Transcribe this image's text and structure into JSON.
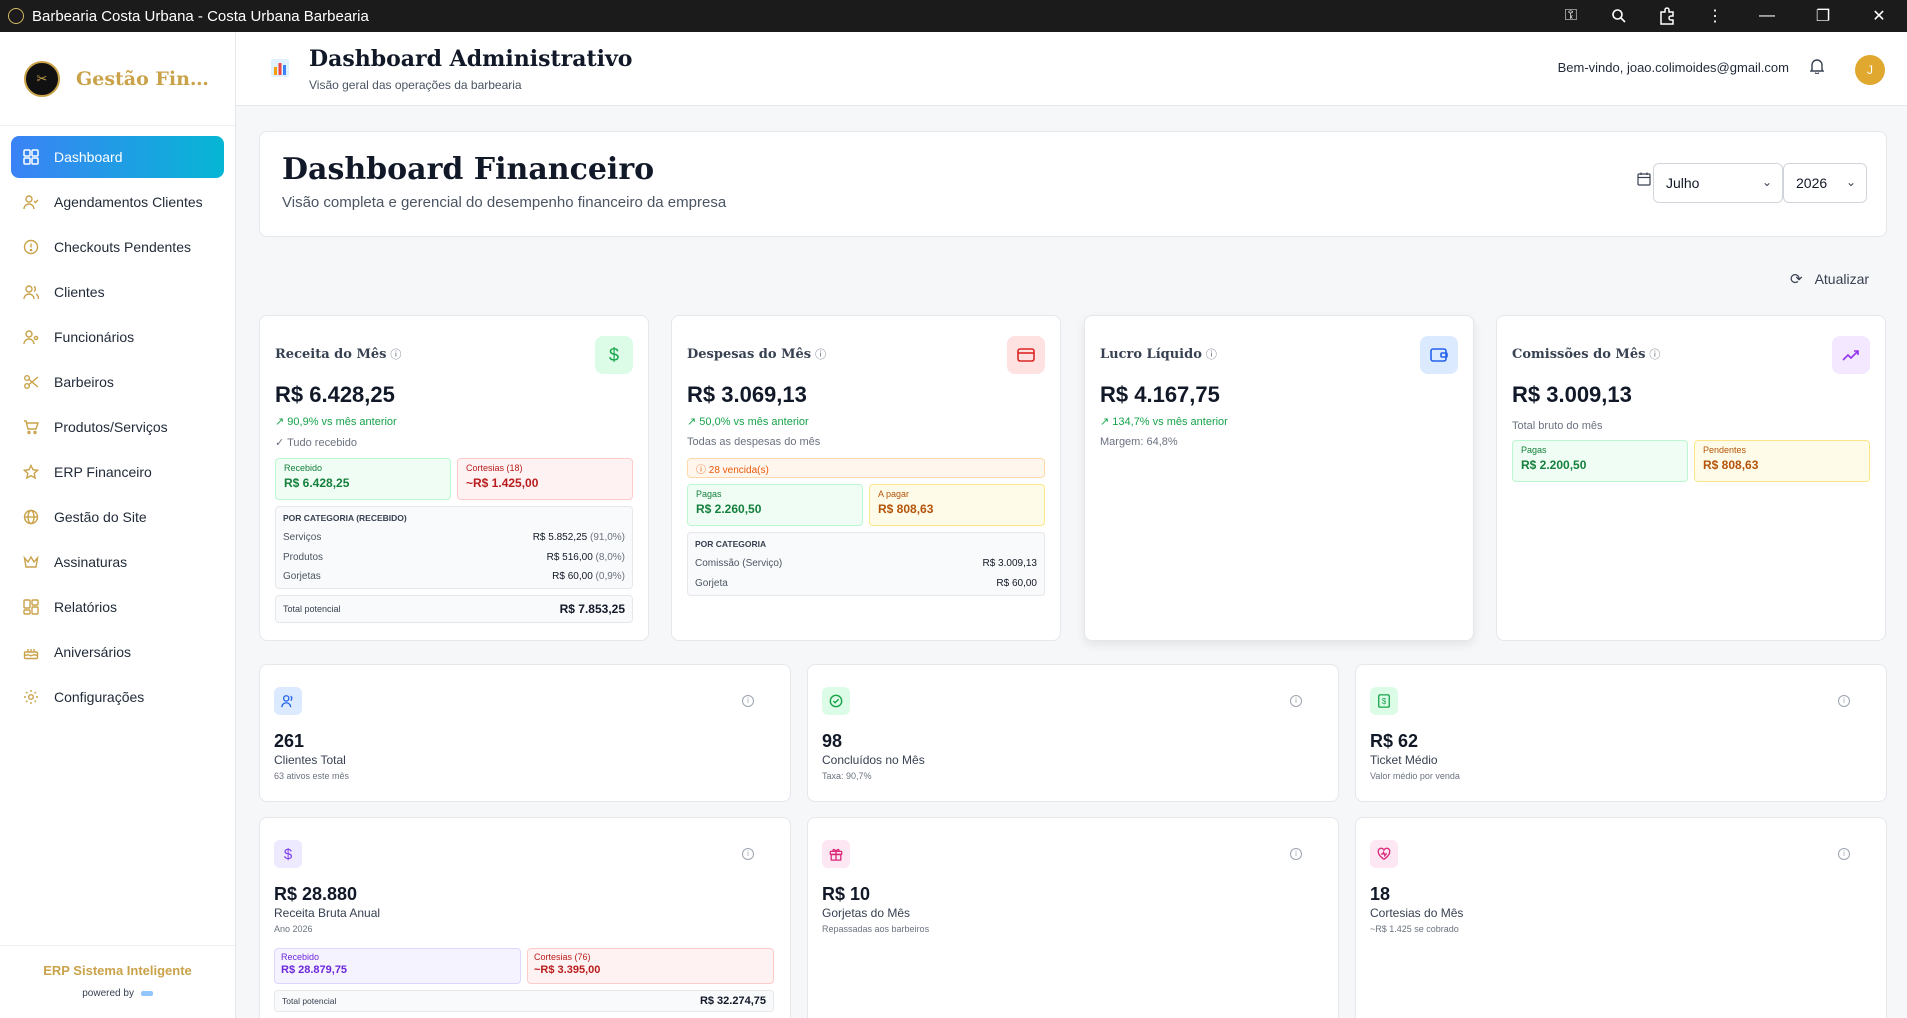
{
  "window": {
    "title": "Barbearia Costa Urbana - Costa Urbana Barbearia"
  },
  "sidebar": {
    "brand": "Gestão Financeira",
    "items": [
      {
        "label": "Dashboard",
        "icon": "grid-icon"
      },
      {
        "label": "Agendamentos Clientes",
        "icon": "user-check-icon"
      },
      {
        "label": "Checkouts Pendentes",
        "icon": "alert-circle-icon"
      },
      {
        "label": "Clientes",
        "icon": "users-icon"
      },
      {
        "label": "Funcionários",
        "icon": "user-cog-icon"
      },
      {
        "label": "Barbeiros",
        "icon": "scissors-icon"
      },
      {
        "label": "Produtos/Serviços",
        "icon": "cart-icon"
      },
      {
        "label": "ERP Financeiro",
        "icon": "star-icon"
      },
      {
        "label": "Gestão do Site",
        "icon": "globe-icon"
      },
      {
        "label": "Assinaturas",
        "icon": "crown-icon"
      },
      {
        "label": "Relatórios",
        "icon": "layout-icon"
      },
      {
        "label": "Aniversários",
        "icon": "cake-icon"
      },
      {
        "label": "Configurações",
        "icon": "gear-icon"
      }
    ],
    "footer_title": "ERP Sistema Inteligente",
    "footer_powered": "powered by"
  },
  "header": {
    "title": "Dashboard Administrativo",
    "subtitle": "Visão geral das operações da barbearia",
    "welcome": "Bem-vindo, joao.colimoides@gmail.com",
    "avatar_initial": "J"
  },
  "banner": {
    "title": "Dashboard Financeiro",
    "subtitle": "Visão completa e gerencial do desempenho financeiro da empresa",
    "month": "Julho",
    "year": "2026"
  },
  "refresh_label": "Atualizar",
  "receita": {
    "label": "Receita do Mês",
    "value": "R$ 6.428,25",
    "trend": "90,9% vs mês anterior",
    "note": "✓ Tudo recebido",
    "recebido_label": "Recebido",
    "recebido_value": "R$ 6.428,25",
    "cortesias_label": "Cortesias (18)",
    "cortesias_value": "~R$ 1.425,00",
    "cat_header": "POR CATEGORIA (RECEBIDO)",
    "categories": [
      {
        "name": "Serviços",
        "value": "R$ 5.852,25",
        "pct": "(91,0%)"
      },
      {
        "name": "Produtos",
        "value": "R$ 516,00",
        "pct": "(8,0%)"
      },
      {
        "name": "Gorjetas",
        "value": "R$ 60,00",
        "pct": "(0,9%)"
      }
    ],
    "total_label": "Total potencial",
    "total_value": "R$ 7.853,25"
  },
  "despesas": {
    "label": "Despesas do Mês",
    "value": "R$ 3.069,13",
    "trend": "50,0% vs mês anterior",
    "note": "Todas as despesas do mês",
    "vencidas": "28 vencida(s)",
    "pagas_label": "Pagas",
    "pagas_value": "R$ 2.260,50",
    "apagar_label": "A pagar",
    "apagar_value": "R$ 808,63",
    "cat_header": "POR CATEGORIA",
    "categories": [
      {
        "name": "Comissão (Serviço)",
        "value": "R$ 3.009,13"
      },
      {
        "name": "Gorjeta",
        "value": "R$ 60,00"
      }
    ]
  },
  "lucro": {
    "label": "Lucro Líquido",
    "value": "R$ 4.167,75",
    "trend": "134,7% vs mês anterior",
    "note": "Margem: 64,8%"
  },
  "comissoes": {
    "label": "Comissões do Mês",
    "value": "R$ 3.009,13",
    "note": "Total bruto do mês",
    "pagas_label": "Pagas",
    "pagas_value": "R$ 2.200,50",
    "pendentes_label": "Pendentes",
    "pendentes_value": "R$ 808,63"
  },
  "stats": [
    {
      "value": "261",
      "label": "Clientes Total",
      "sub": "63 ativos este mês"
    },
    {
      "value": "98",
      "label": "Concluídos no Mês",
      "sub": "Taxa: 90,7%"
    },
    {
      "value": "R$ 62",
      "label": "Ticket Médio",
      "sub": "Valor médio por venda"
    },
    {
      "value": "R$ 28.880",
      "label": "Receita Bruta Anual",
      "sub": "Ano 2026",
      "recebido_label": "Recebido",
      "recebido_value": "R$ 28.879,75",
      "cortesias_label": "Cortesias (76)",
      "cortesias_value": "~R$ 3.395,00",
      "total_label": "Total potencial",
      "total_value": "R$ 32.274,75"
    },
    {
      "value": "R$ 10",
      "label": "Gorjetas do Mês",
      "sub": "Repassadas aos barbeiros"
    },
    {
      "value": "18",
      "label": "Cortesias do Mês",
      "sub": "~R$ 1.425 se cobrado"
    }
  ]
}
